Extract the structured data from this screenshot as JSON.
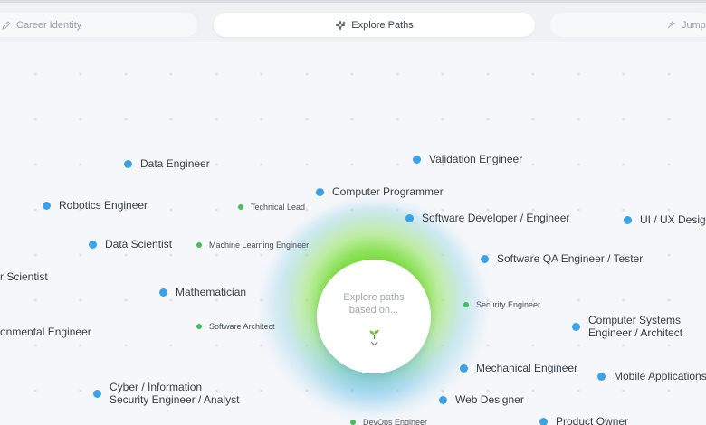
{
  "tabs": [
    {
      "label": "Career Identity",
      "icon": "pen-icon"
    },
    {
      "label": "Explore Paths",
      "icon": "sparkle-icon"
    },
    {
      "label": "Jump",
      "icon": "sparkle-small-icon"
    }
  ],
  "center": {
    "text": "Explore paths based on...",
    "icon": "sprout-icon",
    "chevron": "chevron-down-icon"
  },
  "nodes": [
    {
      "label": "Data Engineer"
    },
    {
      "label": "Validation Engineer"
    },
    {
      "label": "Robotics Engineer"
    },
    {
      "label": "Technical Lead"
    },
    {
      "label": "Computer Programmer"
    },
    {
      "label": "Software Developer / Engineer"
    },
    {
      "label": "UI / UX Design"
    },
    {
      "label": "Data Scientist"
    },
    {
      "label": "Machine Learning Engineer"
    },
    {
      "label": "Software QA Engineer / Tester"
    },
    {
      "label": "r Scientist"
    },
    {
      "label": "Mathematician"
    },
    {
      "label": "Security Engineer"
    },
    {
      "label": "Computer Systems"
    },
    {
      "label": "Engineer / Architect"
    },
    {
      "label": "Software Architect"
    },
    {
      "label": "onmental Engineer"
    },
    {
      "label": "Mechanical Engineer"
    },
    {
      "label": "Mobile Applications"
    },
    {
      "label": "Cyber / Information"
    },
    {
      "label": "Security Engineer / Analyst"
    },
    {
      "label": "Web Designer"
    },
    {
      "label": "DevOps Engineer"
    },
    {
      "label": "Product Owner"
    }
  ],
  "colors": {
    "primary_dot": "#3aa3e6",
    "secondary_dot": "#3fc15a",
    "background": "#f5f7fa"
  }
}
